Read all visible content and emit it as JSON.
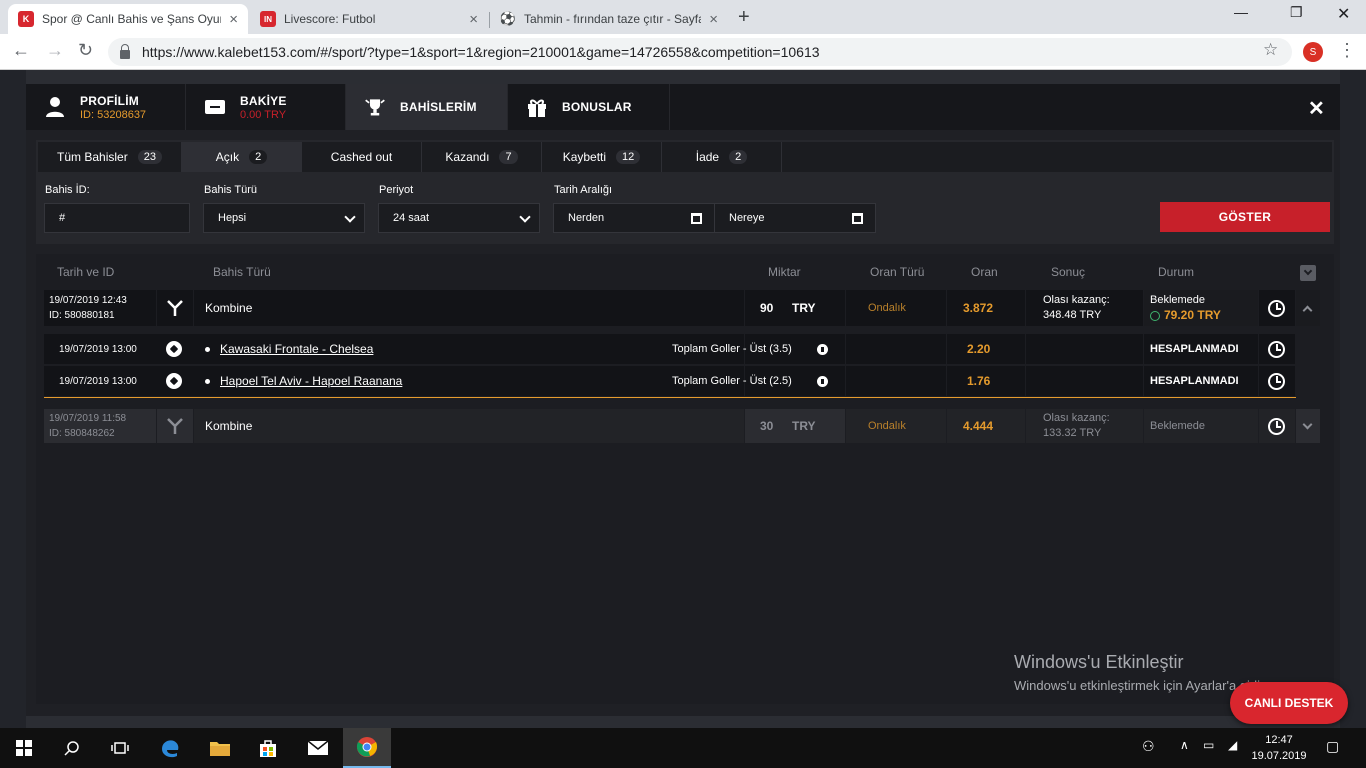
{
  "browser": {
    "tabs": [
      {
        "title": "Spor @ Canlı Bahis ve Şans Oyun",
        "active": true,
        "fav_color": "#d7272f",
        "fav_text": "K"
      },
      {
        "title": "Livescore: Futbol",
        "active": false,
        "fav_color": "#d7272f",
        "fav_text": "IN"
      },
      {
        "title": "Tahmin - fırından taze çıtır - Sayfa",
        "active": false,
        "fav_color": "#333333",
        "fav_text": "⚽"
      }
    ],
    "url": "https://www.kalebet153.com/#/sport/?type=1&sport=1&region=210001&game=14726558&competition=10613",
    "profile_initial": "S"
  },
  "modal": {
    "tabs": [
      {
        "label": "PROFİLİM",
        "sub": "ID: 53208637"
      },
      {
        "label": "BAKİYE",
        "sub": "0.00 TRY"
      },
      {
        "label": "BAHİSLERİM",
        "sub": ""
      },
      {
        "label": "BONUSLAR",
        "sub": ""
      }
    ],
    "close": "✕"
  },
  "filters": {
    "tabs": [
      {
        "label": "Tüm Bahisler",
        "count": "23"
      },
      {
        "label": "Açık",
        "count": "2"
      },
      {
        "label": "Cashed out",
        "count": ""
      },
      {
        "label": "Kazandı",
        "count": "7"
      },
      {
        "label": "Kaybetti",
        "count": "12"
      },
      {
        "label": "İade",
        "count": "2"
      }
    ],
    "bet_id_label": "Bahis İD:",
    "bet_id_value": "#",
    "bet_type_label": "Bahis Türü",
    "bet_type_value": "Hepsi",
    "period_label": "Periyot",
    "period_value": "24 saat",
    "date_range_label": "Tarih Aralığı",
    "from_value": "Nerden",
    "to_value": "Nereye",
    "show_button": "GÖSTER"
  },
  "table": {
    "headers": {
      "date_id": "Tarih ve ID",
      "bet_type": "Bahis Türü",
      "amount": "Miktar",
      "odds_type": "Oran Türü",
      "odds": "Oran",
      "result": "Sonuç",
      "status": "Durum"
    },
    "bets": [
      {
        "date": "19/07/2019 12:43",
        "id": "ID: 580880181",
        "type": "Kombine",
        "amount": "90",
        "currency": "TRY",
        "odds_type": "Ondalık",
        "odds": "3.872",
        "result_label": "Olası kazanç:",
        "result_value": "348.48 TRY",
        "status": "Beklemede",
        "cashout": "79.20 TRY",
        "selections": [
          {
            "date": "19/07/2019 13:00",
            "match": "Kawasaki Frontale - Chelsea",
            "market": "Toplam Goller - Üst (3.5)",
            "odds": "2.20",
            "status": "HESAPLANMADI"
          },
          {
            "date": "19/07/2019 13:00",
            "match": "Hapoel Tel Aviv - Hapoel Raanana",
            "market": "Toplam Goller - Üst (2.5)",
            "odds": "1.76",
            "status": "HESAPLANMADI"
          }
        ]
      },
      {
        "date": "19/07/2019 11:58",
        "id": "ID: 580848262",
        "type": "Kombine",
        "amount": "30",
        "currency": "TRY",
        "odds_type": "Ondalık",
        "odds": "4.444",
        "result_label": "Olası kazanç:",
        "result_value": "133.32",
        "result_currency": "TRY",
        "status": "Beklemede"
      }
    ]
  },
  "overlay": {
    "watermark_title": "Windows'u Etkinleştir",
    "watermark_sub": "Windows'u etkinleştirmek için Ayarlar'a gidin.",
    "live_support": "CANLI DESTEK"
  },
  "taskbar": {
    "time": "12:47",
    "date": "19.07.2019"
  },
  "colors": {
    "accent_red": "#c7202a",
    "odds_orange": "#e59b2d"
  }
}
